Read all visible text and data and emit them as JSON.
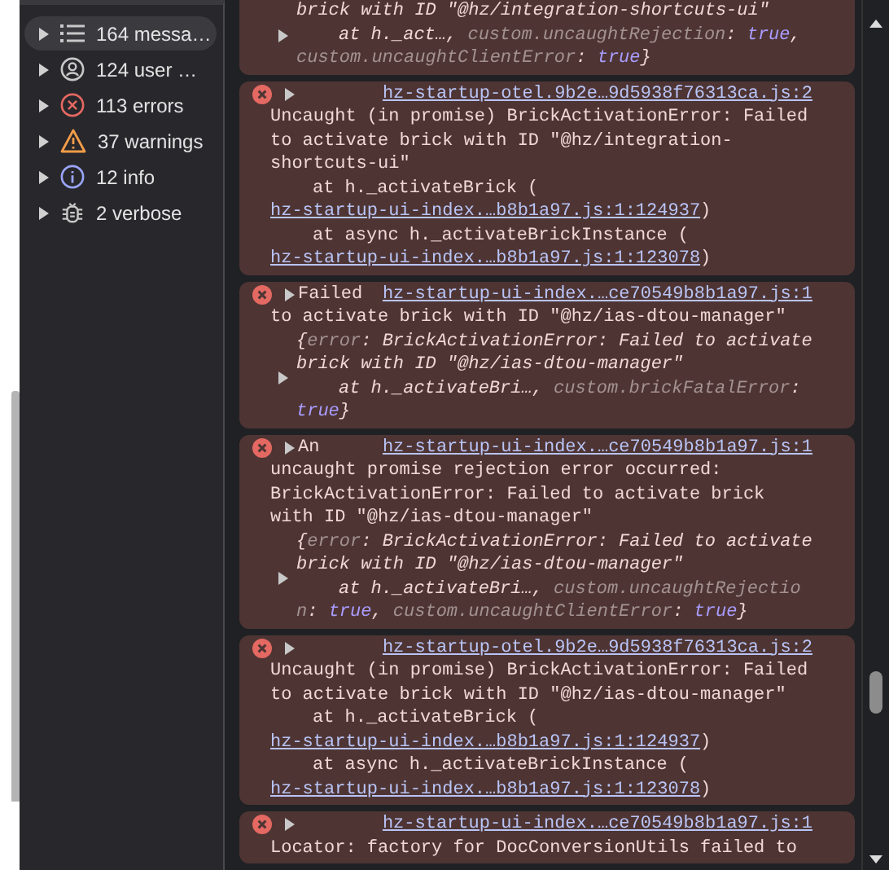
{
  "sidebar": {
    "items": [
      {
        "kind": "list",
        "label": "164 messa…",
        "selected": true
      },
      {
        "kind": "user",
        "label": "124 user …",
        "selected": false
      },
      {
        "kind": "error",
        "label": "113 errors",
        "selected": false
      },
      {
        "kind": "warning",
        "label": "37 warnings",
        "selected": false
      },
      {
        "kind": "info",
        "label": "12 info",
        "selected": false
      },
      {
        "kind": "verbose",
        "label": "2 verbose",
        "selected": false
      }
    ]
  },
  "messages": [
    {
      "kind": "error",
      "body": [
        {
          "kind": "object",
          "expanded": false,
          "lines": [
            {
              "kind": "head",
              "parts": [
                {
                  "text": "brick with ID \"@hz/integration-shortcuts-ui\"",
                  "kind": "plain"
                }
              ]
            },
            {
              "kind": "frame",
              "parts": [
                {
                  "text": "at h._act…, ",
                  "kind": "plain"
                },
                {
                  "text": "custom.uncaughtRejection",
                  "kind": "key"
                },
                {
                  "text": ": ",
                  "kind": "plain"
                },
                {
                  "text": "true",
                  "kind": "bool"
                },
                {
                  "text": ",",
                  "kind": "plain"
                }
              ]
            },
            {
              "kind": "head",
              "parts": [
                {
                  "text": "custom.uncaughtClientError",
                  "kind": "key"
                },
                {
                  "text": ": ",
                  "kind": "plain"
                },
                {
                  "text": "true",
                  "kind": "bool"
                },
                {
                  "text": "}",
                  "kind": "plain"
                }
              ]
            }
          ]
        }
      ]
    },
    {
      "kind": "error",
      "header": {
        "source": "hz-startup-otel.9b2e…9d5938f76313ca.js:2"
      },
      "body": [
        {
          "kind": "text",
          "parts": [
            {
              "text": "Uncaught (in promise) BrickActivationError: Failed",
              "kind": "plain"
            }
          ]
        },
        {
          "kind": "text",
          "parts": [
            {
              "text": "to activate brick with ID \"@hz/integration-",
              "kind": "plain"
            }
          ]
        },
        {
          "kind": "text",
          "parts": [
            {
              "text": "shortcuts-ui\"",
              "kind": "plain"
            }
          ]
        },
        {
          "kind": "frame",
          "parts": [
            {
              "text": "at h._activateBrick (",
              "kind": "plain"
            }
          ]
        },
        {
          "kind": "text",
          "parts": [
            {
              "text": "hz-startup-ui-index.…b8b1a97.js:1:124937",
              "kind": "link"
            },
            {
              "text": ")",
              "kind": "plain"
            }
          ]
        },
        {
          "kind": "frame",
          "parts": [
            {
              "text": "at async h._activateBrickInstance (",
              "kind": "plain"
            }
          ]
        },
        {
          "kind": "text",
          "parts": [
            {
              "text": "hz-startup-ui-index.…b8b1a97.js:1:123078",
              "kind": "link"
            },
            {
              "text": ")",
              "kind": "plain"
            }
          ]
        }
      ]
    },
    {
      "kind": "error",
      "header": {
        "summary": "Failed",
        "source": "hz-startup-ui-index.…ce70549b8b1a97.js:1"
      },
      "body": [
        {
          "kind": "text",
          "parts": [
            {
              "text": "to activate brick with ID \"@hz/ias-dtou-manager\"",
              "kind": "plain"
            }
          ]
        },
        {
          "kind": "object",
          "expanded": false,
          "lines": [
            {
              "kind": "head",
              "parts": [
                {
                  "text": "{",
                  "kind": "plain"
                },
                {
                  "text": "error",
                  "kind": "key"
                },
                {
                  "text": ": BrickActivationError: Failed to activate",
                  "kind": "plain"
                }
              ]
            },
            {
              "kind": "head",
              "parts": [
                {
                  "text": "brick with ID \"@hz/ias-dtou-manager\"",
                  "kind": "plain"
                }
              ]
            },
            {
              "kind": "frame",
              "parts": [
                {
                  "text": "at h._activateBri…, ",
                  "kind": "plain"
                },
                {
                  "text": "custom.brickFatalError",
                  "kind": "key"
                },
                {
                  "text": ":",
                  "kind": "plain"
                }
              ]
            },
            {
              "kind": "head",
              "parts": [
                {
                  "text": "true",
                  "kind": "bool"
                },
                {
                  "text": "}",
                  "kind": "plain"
                }
              ]
            }
          ]
        }
      ]
    },
    {
      "kind": "error",
      "header": {
        "summary": "An",
        "source": "hz-startup-ui-index.…ce70549b8b1a97.js:1"
      },
      "body": [
        {
          "kind": "text",
          "parts": [
            {
              "text": "uncaught promise rejection error occurred:",
              "kind": "plain"
            }
          ]
        },
        {
          "kind": "text",
          "parts": [
            {
              "text": "BrickActivationError: Failed to activate brick",
              "kind": "plain"
            }
          ]
        },
        {
          "kind": "text",
          "parts": [
            {
              "text": "with ID \"@hz/ias-dtou-manager\"",
              "kind": "plain"
            }
          ]
        },
        {
          "kind": "object",
          "expanded": false,
          "lines": [
            {
              "kind": "head",
              "parts": [
                {
                  "text": "{",
                  "kind": "plain"
                },
                {
                  "text": "error",
                  "kind": "key"
                },
                {
                  "text": ": BrickActivationError: Failed to activate",
                  "kind": "plain"
                }
              ]
            },
            {
              "kind": "head",
              "parts": [
                {
                  "text": "brick with ID \"@hz/ias-dtou-manager\"",
                  "kind": "plain"
                }
              ]
            },
            {
              "kind": "frame",
              "parts": [
                {
                  "text": "at h._activateBri…, ",
                  "kind": "plain"
                },
                {
                  "text": "custom.uncaughtRejectio",
                  "kind": "key"
                }
              ]
            },
            {
              "kind": "head",
              "parts": [
                {
                  "text": "n",
                  "kind": "key"
                },
                {
                  "text": ": ",
                  "kind": "plain"
                },
                {
                  "text": "true",
                  "kind": "bool"
                },
                {
                  "text": ", ",
                  "kind": "plain"
                },
                {
                  "text": "custom.uncaughtClientError",
                  "kind": "key"
                },
                {
                  "text": ": ",
                  "kind": "plain"
                },
                {
                  "text": "true",
                  "kind": "bool"
                },
                {
                  "text": "}",
                  "kind": "plain"
                }
              ]
            }
          ]
        }
      ]
    },
    {
      "kind": "error",
      "header": {
        "source": "hz-startup-otel.9b2e…9d5938f76313ca.js:2"
      },
      "body": [
        {
          "kind": "text",
          "parts": [
            {
              "text": "Uncaught (in promise) BrickActivationError: Failed",
              "kind": "plain"
            }
          ]
        },
        {
          "kind": "text",
          "parts": [
            {
              "text": "to activate brick with ID \"@hz/ias-dtou-manager\"",
              "kind": "plain"
            }
          ]
        },
        {
          "kind": "frame",
          "parts": [
            {
              "text": "at h._activateBrick (",
              "kind": "plain"
            }
          ]
        },
        {
          "kind": "text",
          "parts": [
            {
              "text": "hz-startup-ui-index.…b8b1a97.js:1:124937",
              "kind": "link"
            },
            {
              "text": ")",
              "kind": "plain"
            }
          ]
        },
        {
          "kind": "frame",
          "parts": [
            {
              "text": "at async h._activateBrickInstance (",
              "kind": "plain"
            }
          ]
        },
        {
          "kind": "text",
          "parts": [
            {
              "text": "hz-startup-ui-index.…b8b1a97.js:1:123078",
              "kind": "link"
            },
            {
              "text": ")",
              "kind": "plain"
            }
          ]
        }
      ]
    },
    {
      "kind": "error",
      "header": {
        "source": "hz-startup-ui-index.…ce70549b8b1a97.js:1"
      },
      "body": [
        {
          "kind": "text",
          "parts": [
            {
              "text": "Locator: factory for DocConversionUtils failed to",
              "kind": "plain"
            }
          ]
        }
      ]
    }
  ]
}
